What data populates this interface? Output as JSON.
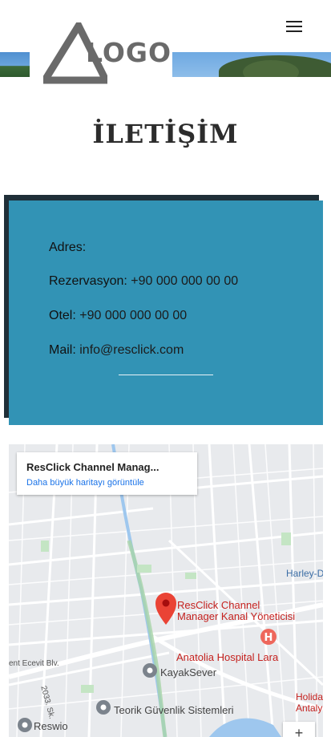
{
  "header": {
    "logo_text": "LOGO",
    "menu_icon": "hamburger-menu-icon"
  },
  "page": {
    "title": "İLETİŞİM"
  },
  "contact": {
    "address_label": "Adres:",
    "address_value": "",
    "reservation_label": "Rezervasyon:",
    "reservation_value": "+90 000 000 00 00",
    "hotel_label": "Otel:",
    "hotel_value": "+90 000 000 00 00",
    "mail_label": "Mail:",
    "mail_value": "info@resclick.com",
    "card_color": "#3293b5"
  },
  "map": {
    "place_name": "ResClick Channel Manag...",
    "view_larger_link": "Daha büyük haritayı görüntüle",
    "marker_label_line1": "ResClick Channel",
    "marker_label_line2": "Manager Kanal Yöneticisi",
    "labels": {
      "harley": "Harley-D",
      "anatolia": "Anatolia Hospital Lara",
      "ecevit": "ent Ecevit Blv.",
      "kayak": "KayakSever",
      "street": "2033. Sk.",
      "teorik": "Teorik Güvenlik Sistemleri",
      "holiday1": "Holiday",
      "holiday2": "Antalya - L",
      "reswio": "Reswio"
    },
    "zoom_in": "+"
  }
}
